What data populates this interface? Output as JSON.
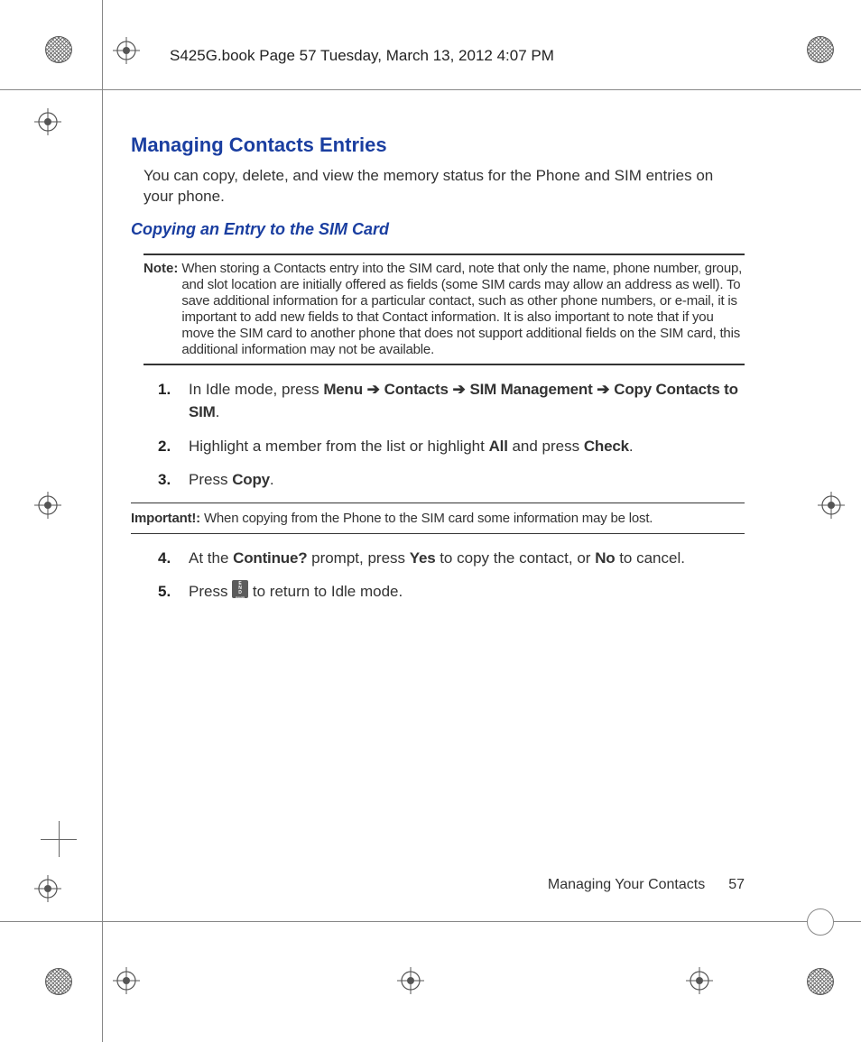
{
  "header": {
    "running_head": "S425G.book  Page 57  Tuesday, March 13, 2012  4:07 PM"
  },
  "sections": {
    "title": "Managing Contacts Entries",
    "intro": "You can copy, delete, and view the memory status for the Phone and SIM entries on your phone.",
    "subtitle": "Copying an Entry to the SIM Card",
    "note_label": "Note:",
    "note_body": "When storing a Contacts entry into the SIM card, note that only the name, phone number, group, and slot location are initially offered as fields (some SIM cards may allow an address as well). To save additional information for a particular contact, such as other phone numbers, or e-mail, it is important to add new fields to that Contact information. It is also important to note that if you move the SIM card to another phone that does not support additional fields on the SIM card, this additional information may not be available.",
    "steps_a": {
      "s1_pre": "In Idle mode, press ",
      "s1_menu": "Menu",
      "s1_contacts": "Contacts",
      "s1_sim": "SIM Management",
      "s1_copy": "Copy Contacts to SIM",
      "s2_pre": "Highlight a member from the list or highlight ",
      "s2_all": "All",
      "s2_mid": " and press ",
      "s2_check": "Check",
      "s3_pre": "Press ",
      "s3_copy": "Copy"
    },
    "important_label": "Important!:",
    "important_body": "When copying from the Phone to the SIM card some information may be lost.",
    "steps_b": {
      "s4_pre": "At the ",
      "s4_continue": "Continue?",
      "s4_mid1": " prompt, press ",
      "s4_yes": "Yes",
      "s4_mid2": " to copy the contact, or ",
      "s4_no": "No",
      "s4_post": " to cancel.",
      "s5_pre": "Press ",
      "s5_post": " to return to Idle mode."
    },
    "arrow": "➔",
    "end_key": {
      "l1": "E",
      "l2": "N",
      "l3": "D",
      "l4": "PWR"
    }
  },
  "footer": {
    "section_name": "Managing Your Contacts",
    "page_number": "57"
  }
}
